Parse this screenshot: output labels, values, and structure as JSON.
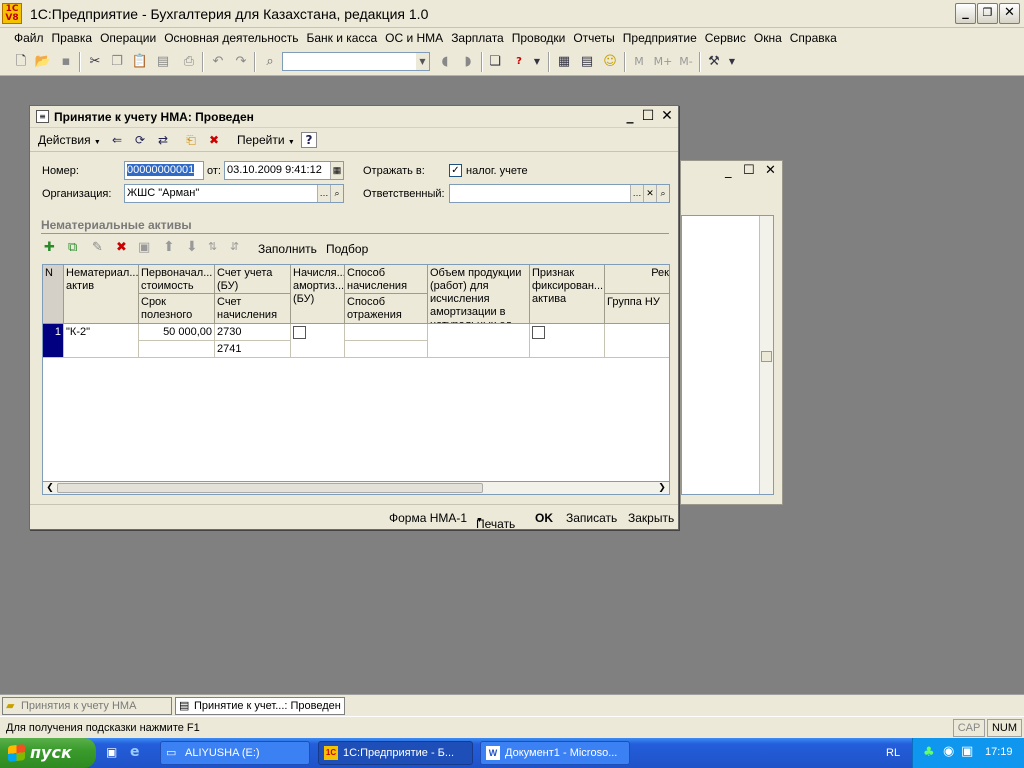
{
  "app": {
    "icon_text": "1C V8",
    "title": "1С:Предприятие - Бухгалтерия для Казахстана, редакция 1.0"
  },
  "menu": [
    "Файл",
    "Правка",
    "Операции",
    "Основная деятельность",
    "Банк и касса",
    "ОС и НМА",
    "Зарплата",
    "Проводки",
    "Отчеты",
    "Предприятие",
    "Сервис",
    "Окна",
    "Справка"
  ],
  "toolbar": {
    "icons": [
      "new-document-icon",
      "open-icon",
      "save-icon",
      "cut-icon",
      "copy-icon",
      "paste-icon",
      "print-preview-icon",
      "undo-icon",
      "redo-icon",
      "find-icon"
    ],
    "search_value": "",
    "m_buttons": [
      "M",
      "M+",
      "M-"
    ]
  },
  "dialog": {
    "title": "Принятие к учету НМА: Проведен",
    "toolbar": {
      "actions": "Действия",
      "goto": "Перейти",
      "help": "?"
    },
    "form": {
      "number_label": "Номер:",
      "number_value": "00000000001",
      "from_label": "от:",
      "date_value": "03.10.2009  9:41:12",
      "org_label": "Организация:",
      "org_value": "ЖШС \"Арман\"",
      "reflect_label": "Отражать в:",
      "reflect_checkbox_label": "налог. учете",
      "reflect_checked": true,
      "responsible_label": "Ответственный:",
      "responsible_value": ""
    },
    "section_title": "Нематериальные активы",
    "table_toolbar": {
      "fill": "Заполнить",
      "select": "Подбор"
    },
    "table": {
      "headers": {
        "n": "N",
        "asset": "Нематериал...\nактив",
        "initial_cost": "Первоначал...\nстоимость",
        "useful_life": "Срок\nполезного",
        "account": "Счет учета\n(БУ)",
        "accrual_account": "Счет\nначисления",
        "amortization": "Начисля...\nамортиз...\n(БУ)",
        "method": "Способ\nначисления",
        "reflection_method": "Способ\nотражения",
        "volume": "Объем продукции\n(работ) для\nисчисления\nамортизации в\nнатуральных ед.",
        "fixation": "Признак\nфиксирован...\nактива",
        "rek": "Рек",
        "nu_group": "Группа НУ"
      },
      "rows": [
        {
          "n": "1",
          "asset": "\"К-2\"",
          "cost": "50 000,00",
          "useful_life": "",
          "account": "2730",
          "accrual_account": "2741",
          "amortization_checked": false,
          "method": "",
          "reflection_method": "",
          "volume": "",
          "fixation_checked": false,
          "nu_group": ""
        }
      ]
    },
    "footer": {
      "form": "Форма НМА-1",
      "print": "Печать",
      "ok": "OK",
      "save": "Записать",
      "close": "Закрыть"
    }
  },
  "window_tabs": [
    {
      "label": "Принятия к учету НМА",
      "active": false
    },
    {
      "label": "Принятие к учет...: Проведен",
      "active": true
    }
  ],
  "status": {
    "hint": "Для получения подсказки нажмите F1",
    "cap": "CAP",
    "num": "NUM"
  },
  "taskbar": {
    "start": "пуск",
    "tasks": [
      {
        "label": "ALIYUSHA (E:)",
        "active": false
      },
      {
        "label": "1С:Предприятие - Б...",
        "active": true
      },
      {
        "label": "Документ1 - Microso...",
        "active": false
      }
    ],
    "lang": "RL",
    "time": "17:19"
  }
}
